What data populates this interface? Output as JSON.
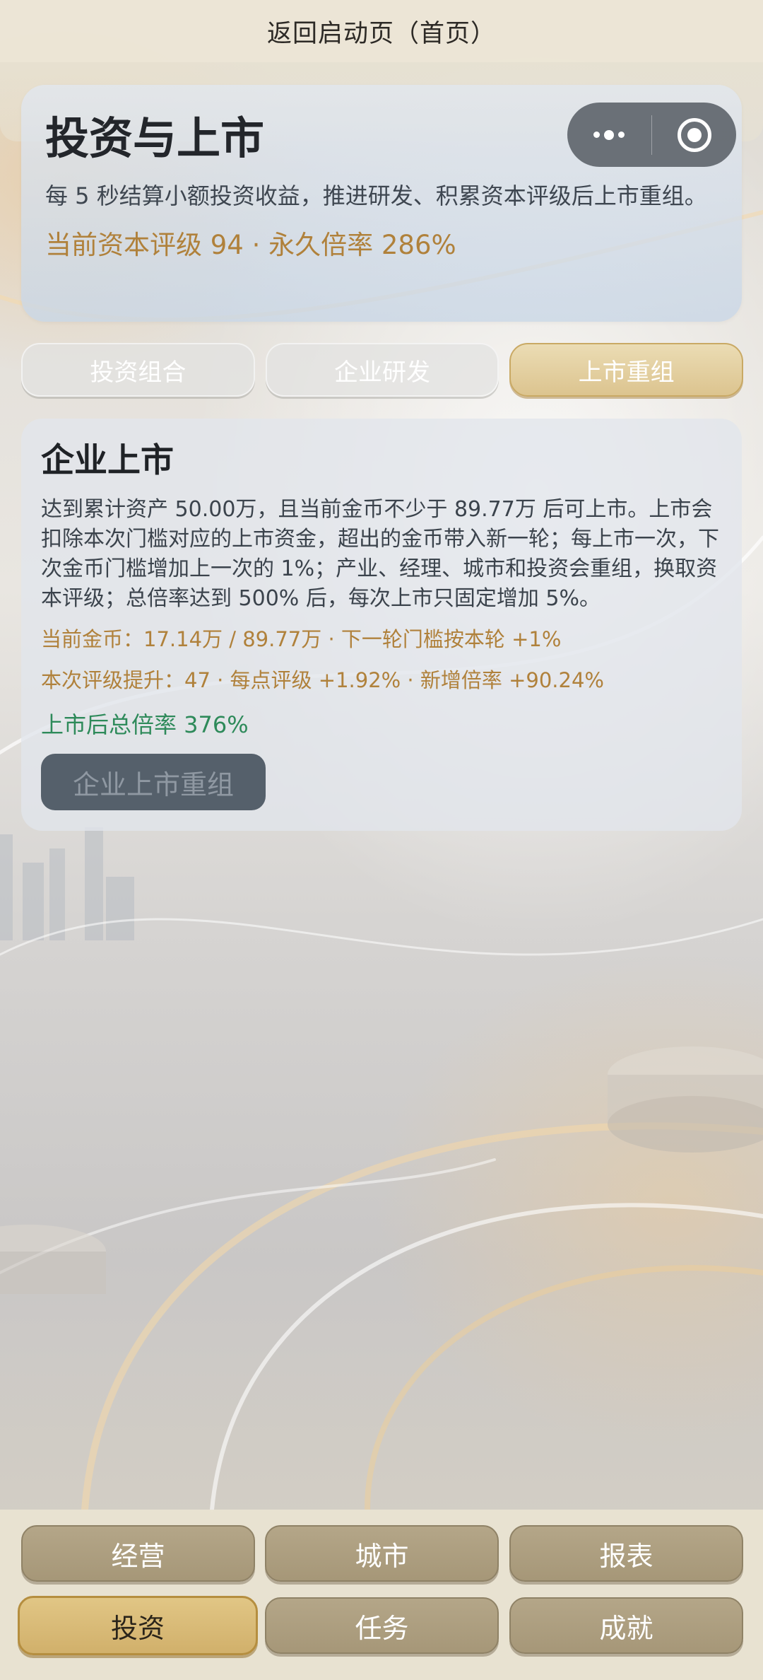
{
  "topbar": {
    "title": "返回启动页（首页）"
  },
  "capsule": {
    "more_icon": "more-dots-icon",
    "close_icon": "target-circle-icon"
  },
  "header": {
    "title": "投资与上市",
    "description": "每 5 秒结算小额投资收益，推进研发、积累资本评级后上市重组。",
    "stats": "当前资本评级 94 · 永久倍率 286%"
  },
  "tabs": [
    {
      "label": "投资组合",
      "active": false
    },
    {
      "label": "企业研发",
      "active": false
    },
    {
      "label": "上市重组",
      "active": true
    }
  ],
  "main": {
    "title": "企业上市",
    "description": "达到累计资产 50.00万，且当前金币不少于 89.77万 后可上市。上市会扣除本次门槛对应的上市资金，超出的金币带入新一轮；每上市一次，下次金币门槛增加上一次的 1%；产业、经理、城市和投资会重组，换取资本评级；总倍率达到 500% 后，每次上市只固定增加 5%。",
    "coins_line": "当前金币：17.14万 / 89.77万 · 下一轮门槛按本轮 +1%",
    "rating_line": "本次评级提升：47 · 每点评级 +1.92% · 新增倍率 +90.24%",
    "total_line": "上市后总倍率 376%",
    "button_label": "企业上市重组"
  },
  "bottom_nav": {
    "row1": [
      {
        "label": "经营",
        "active": false
      },
      {
        "label": "城市",
        "active": false
      },
      {
        "label": "报表",
        "active": false
      }
    ],
    "row2": [
      {
        "label": "投资",
        "active": true
      },
      {
        "label": "任务",
        "active": false
      },
      {
        "label": "成就",
        "active": false
      }
    ]
  },
  "colors": {
    "accent_gold": "#b0813b",
    "positive_green": "#2e8a5a",
    "active_tab": "#dcc48f",
    "nav_button": "#a69778"
  }
}
